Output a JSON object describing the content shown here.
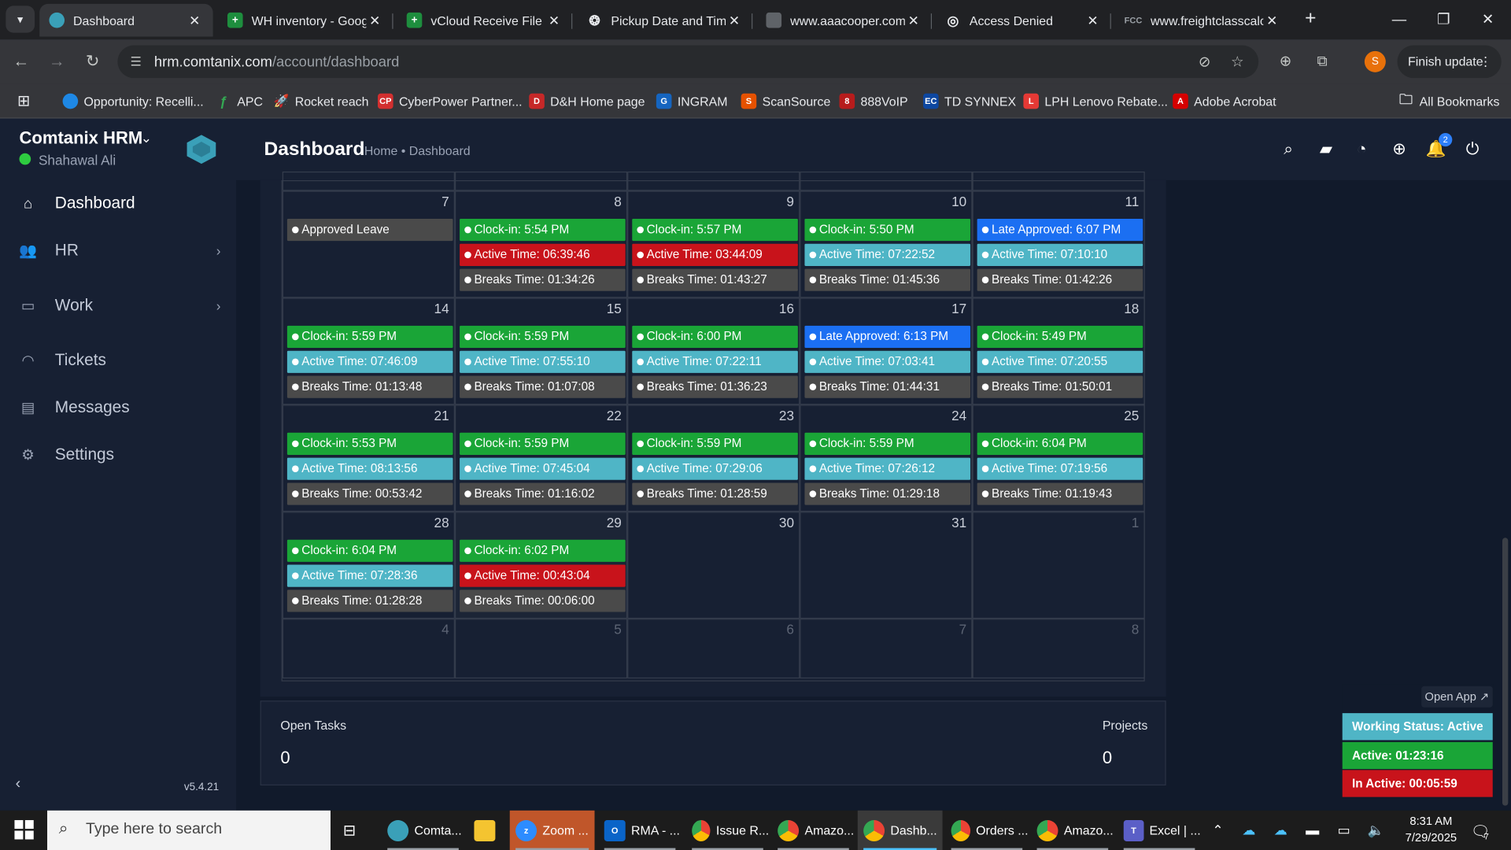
{
  "browser": {
    "tabs": [
      {
        "title": "Dashboard",
        "active": true,
        "icon": "comtanix-icon"
      },
      {
        "title": "WH inventory - Goog",
        "icon": "sheets-icon"
      },
      {
        "title": "vCloud Receive File -",
        "icon": "sheets-icon"
      },
      {
        "title": "Pickup Date and Tim",
        "icon": "openai-icon"
      },
      {
        "title": "www.aaacooper.com",
        "icon": "page-icon"
      },
      {
        "title": "Access Denied",
        "icon": "globe-icon"
      },
      {
        "title": "www.freightclasscalc",
        "icon": "fcc-icon"
      }
    ],
    "url_host": "hrm.comtanix.com",
    "url_path": "/account/dashboard",
    "profile_initial": "S",
    "finish_update": "Finish update",
    "bookmarks": [
      "Opportunity: Recelli...",
      "APC",
      "Rocket reach",
      "CyberPower Partner...",
      "D&H Home page",
      "INGRAM",
      "ScanSource",
      "888VoIP",
      "TD SYNNEX",
      "LPH Lenovo Rebate...",
      "Adobe Acrobat"
    ],
    "all_bookmarks": "All Bookmarks"
  },
  "sidebar": {
    "brand": "Comtanix HRM",
    "user": "Shahawal Ali",
    "items": [
      "Dashboard",
      "HR",
      "Work",
      "Tickets",
      "Messages",
      "Settings"
    ],
    "version": "v5.4.21"
  },
  "header": {
    "title": "Dashboard",
    "breadcrumb": "Home • Dashboard",
    "notification_count": "2"
  },
  "calendar": {
    "weeks": [
      {
        "days": [
          "7",
          "8",
          "9",
          "10",
          "11"
        ]
      },
      {
        "days": [
          "14",
          "15",
          "16",
          "17",
          "18"
        ]
      },
      {
        "days": [
          "21",
          "22",
          "23",
          "24",
          "25"
        ]
      },
      {
        "days": [
          "28",
          "29",
          "30",
          "31",
          "1"
        ]
      },
      {
        "days": [
          "4",
          "5",
          "6",
          "7",
          "8"
        ]
      }
    ],
    "events": {
      "d7": [
        "Approved Leave"
      ],
      "d8": [
        "Clock-in: 5:54 PM",
        "Active Time: 06:39:46",
        "Breaks Time: 01:34:26"
      ],
      "d9": [
        "Clock-in: 5:57 PM",
        "Active Time: 03:44:09",
        "Breaks Time: 01:43:27"
      ],
      "d10": [
        "Clock-in: 5:50 PM",
        "Active Time: 07:22:52",
        "Breaks Time: 01:45:36"
      ],
      "d11": [
        "Late Approved: 6:07 PM",
        "Active Time: 07:10:10",
        "Breaks Time: 01:42:26"
      ],
      "d14": [
        "Clock-in: 5:59 PM",
        "Active Time: 07:46:09",
        "Breaks Time: 01:13:48"
      ],
      "d15": [
        "Clock-in: 5:59 PM",
        "Active Time: 07:55:10",
        "Breaks Time: 01:07:08"
      ],
      "d16": [
        "Clock-in: 6:00 PM",
        "Active Time: 07:22:11",
        "Breaks Time: 01:36:23"
      ],
      "d17": [
        "Late Approved: 6:13 PM",
        "Active Time: 07:03:41",
        "Breaks Time: 01:44:31"
      ],
      "d18": [
        "Clock-in: 5:49 PM",
        "Active Time: 07:20:55",
        "Breaks Time: 01:50:01"
      ],
      "d21": [
        "Clock-in: 5:53 PM",
        "Active Time: 08:13:56",
        "Breaks Time: 00:53:42"
      ],
      "d22": [
        "Clock-in: 5:59 PM",
        "Active Time: 07:45:04",
        "Breaks Time: 01:16:02"
      ],
      "d23": [
        "Clock-in: 5:59 PM",
        "Active Time: 07:29:06",
        "Breaks Time: 01:28:59"
      ],
      "d24": [
        "Clock-in: 5:59 PM",
        "Active Time: 07:26:12",
        "Breaks Time: 01:29:18"
      ],
      "d25": [
        "Clock-in: 6:04 PM",
        "Active Time: 07:19:56",
        "Breaks Time: 01:19:43"
      ],
      "d28": [
        "Clock-in: 6:04 PM",
        "Active Time: 07:28:36",
        "Breaks Time: 01:28:28"
      ],
      "d29": [
        "Clock-in: 6:02 PM",
        "Active Time: 00:43:04",
        "Breaks Time: 00:06:00"
      ]
    },
    "colors": {
      "clockin": "#1aa537",
      "active_ok": "#4fb5c6",
      "active_low": "#c8131b",
      "breaks": "#4a4a4a",
      "late": "#1b6ff2",
      "leave": "#4a4a4a"
    }
  },
  "stats": {
    "open_tasks_label": "Open Tasks",
    "open_tasks_value": "0",
    "projects_label": "Projects",
    "projects_value": "0"
  },
  "status_widget": {
    "open_app": "Open App ↗",
    "working_status": "Working Status: Active",
    "active": "Active: 01:23:16",
    "inactive": "In Active: 00:05:59"
  },
  "taskbar": {
    "search_placeholder": "Type here to search",
    "apps": [
      "Comta...",
      "Zoom ...",
      "RMA - ...",
      "Issue R...",
      "Amazo...",
      "Dashb...",
      "Orders ...",
      "Amazo...",
      "Excel | ..."
    ],
    "time": "8:31 AM",
    "date": "7/29/2025",
    "notification_count": "7"
  }
}
